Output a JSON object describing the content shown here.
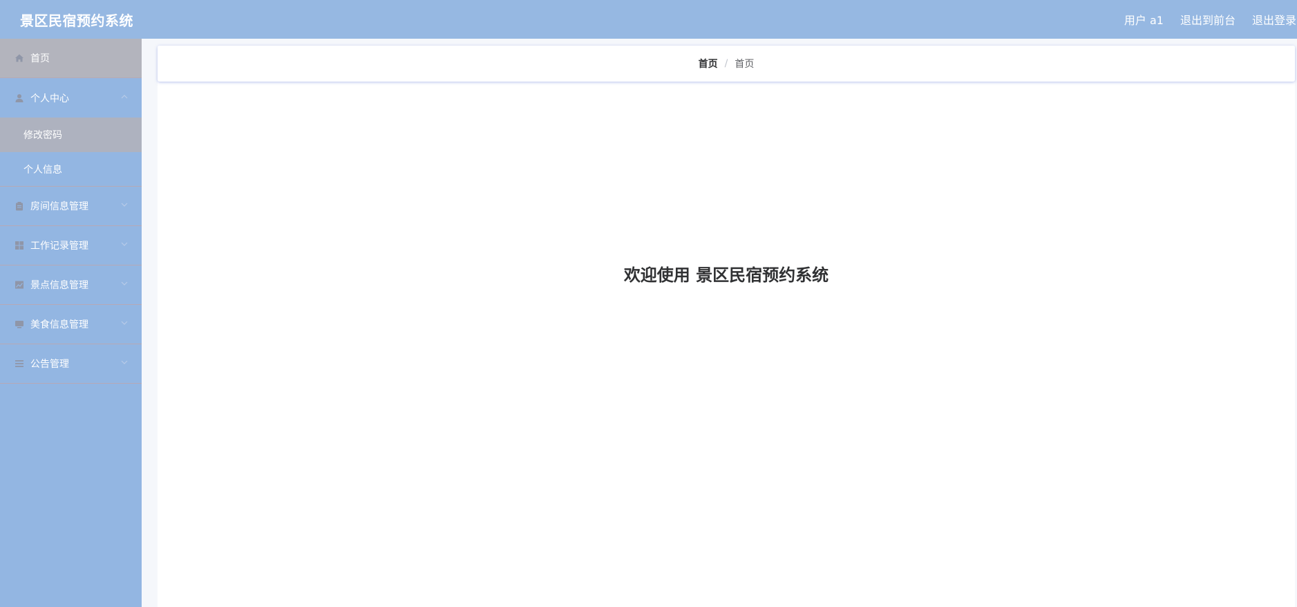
{
  "header": {
    "app_title": "景区民宿预约系统",
    "user_label": "用户 a1",
    "back_to_front": "退出到前台",
    "logout": "退出登录",
    "bg_color": "#96b8e2"
  },
  "sidebar": {
    "items": [
      {
        "label": "首页",
        "icon": "home-icon",
        "active": true
      },
      {
        "label": "个人中心",
        "icon": "user-icon",
        "expanded": true,
        "children": [
          {
            "label": "修改密码",
            "active": true
          },
          {
            "label": "个人信息"
          }
        ]
      },
      {
        "label": "房间信息管理",
        "icon": "clipboard-icon"
      },
      {
        "label": "工作记录管理",
        "icon": "grid-icon"
      },
      {
        "label": "景点信息管理",
        "icon": "chart-icon"
      },
      {
        "label": "美食信息管理",
        "icon": "monitor-icon"
      },
      {
        "label": "公告管理",
        "icon": "list-icon"
      }
    ]
  },
  "breadcrumb": {
    "root": "首页",
    "separator": "/",
    "current": "首页"
  },
  "main": {
    "welcome_text": "欢迎使用 景区民宿预约系统"
  }
}
